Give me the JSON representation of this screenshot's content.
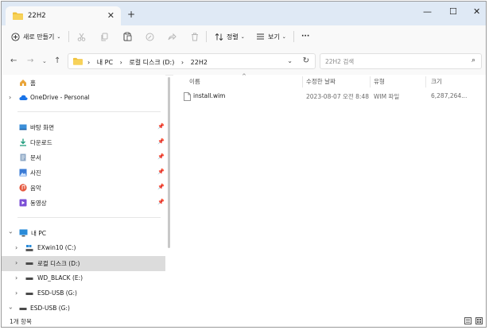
{
  "tab": {
    "title": "22H2",
    "close_glyph": "✕",
    "new_tab_glyph": "+"
  },
  "window_controls": {
    "minimize": "—",
    "maximize": "☐",
    "close": "✕"
  },
  "toolbar": {
    "new_label": "새로 만들기",
    "sort_label": "정렬",
    "view_label": "보기",
    "more_label": "···",
    "icons": [
      "add-icon",
      "cut-icon",
      "copy-icon",
      "paste-icon",
      "rename-icon",
      "share-icon",
      "delete-icon",
      "sort-icon",
      "view-icon",
      "more-icon"
    ]
  },
  "address": {
    "crumbs": [
      "내 PC",
      "로컬 디스크 (D:)",
      "22H2"
    ],
    "separator": "›"
  },
  "search": {
    "placeholder": "22H2 검색"
  },
  "nav": {
    "home": "홈",
    "onedrive": "OneDrive - Personal",
    "quick": [
      "바탕 화면",
      "다운로드",
      "문서",
      "사진",
      "음악",
      "동영상"
    ],
    "this_pc": "내 PC",
    "drives": [
      "EXwin10 (C:)",
      "로컬 디스크 (D:)",
      "WD_BLACK (E:)",
      "ESD-USB (G:)",
      "ESD-USB (G:)"
    ],
    "pin_glyph": "📌"
  },
  "columns": {
    "name": "이름",
    "modified": "수정한 날짜",
    "type": "유형",
    "size": "크기"
  },
  "files": [
    {
      "name": "install.wim",
      "modified": "2023-08-07 오전 8:48",
      "type": "WIM 파일",
      "size": "6,287,264..."
    }
  ],
  "status": {
    "count": "1개 항목"
  },
  "colors": {
    "titlebar": "#dfe9f5",
    "folder": "#f0c13a",
    "selected": "#dcdcdc",
    "accent": "#0067c0"
  }
}
